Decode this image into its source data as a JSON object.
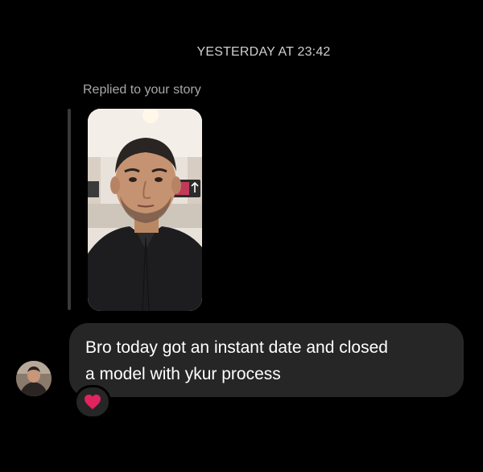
{
  "thread": {
    "timestamp": "YESTERDAY AT 23:42",
    "reply_context_label": "Replied to your story"
  },
  "message": {
    "line1": "Bro today got an instant date and closed",
    "line2": "a model with ykur process",
    "reaction": "heart"
  },
  "colors": {
    "background": "#000000",
    "bubble": "#262626",
    "reaction": "#e0245e"
  }
}
